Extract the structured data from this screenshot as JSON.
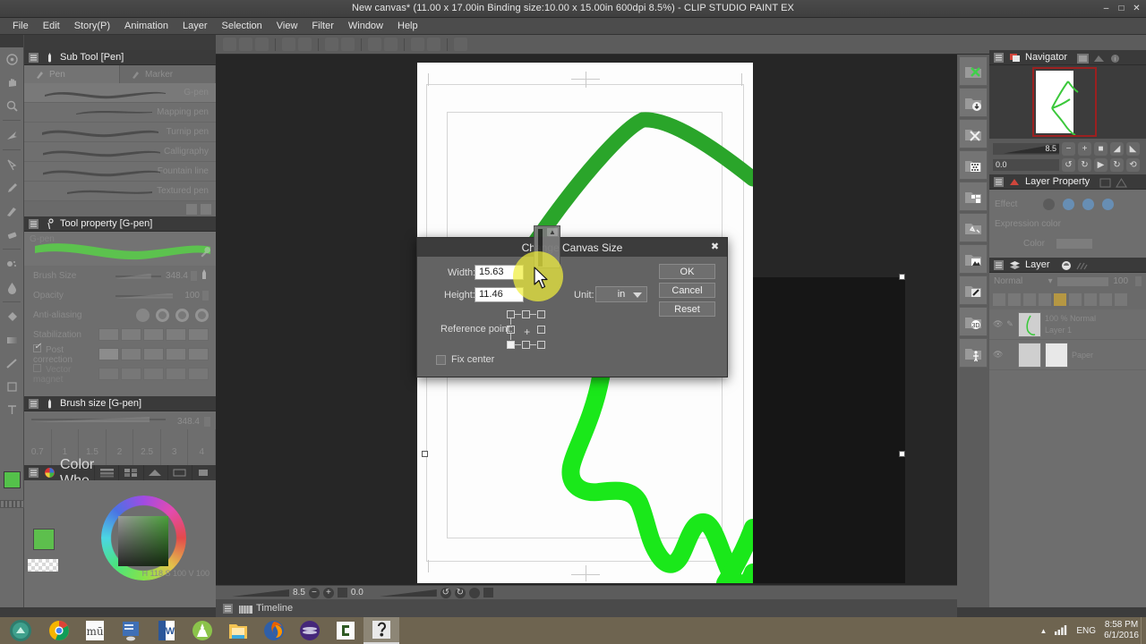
{
  "window": {
    "title": "New canvas* (11.00 x 17.00in Binding size:10.00 x 15.00in 600dpi 8.5%)  - CLIP STUDIO PAINT EX",
    "minimize": "–",
    "maximize": "□",
    "close": "✕"
  },
  "menubar": {
    "items": [
      "File",
      "Edit",
      "Story(P)",
      "Animation",
      "Layer",
      "Selection",
      "View",
      "Filter",
      "Window",
      "Help"
    ]
  },
  "subtool": {
    "title": "Sub Tool [Pen]",
    "tabs": [
      {
        "label": "Pen",
        "active": true
      },
      {
        "label": "Marker",
        "active": false
      }
    ],
    "items": [
      {
        "label": "G-pen",
        "selected": true
      },
      {
        "label": "Mapping pen",
        "selected": false
      },
      {
        "label": "Turnip pen",
        "selected": false
      },
      {
        "label": "Calligraphy",
        "selected": false
      },
      {
        "label": "Fountain line",
        "selected": false
      },
      {
        "label": "Textured pen",
        "selected": false
      }
    ]
  },
  "toolproperty": {
    "title": "Tool property [G-pen]",
    "preview_label": "G-pen",
    "rows": [
      {
        "name": "Brush Size",
        "value": "348.4"
      },
      {
        "name": "Opacity",
        "value": "100"
      },
      {
        "name": "Anti-aliasing",
        "value": ""
      },
      {
        "name": "Stabilization",
        "value": ""
      },
      {
        "name": "Post correction",
        "value": ""
      },
      {
        "name": "Vector magnet",
        "value": ""
      }
    ]
  },
  "brushsize": {
    "title": "Brush size [G-pen]",
    "current": "348.4",
    "presets": [
      "0.7",
      "1",
      "1.5",
      "2",
      "2.5",
      "3",
      "4"
    ]
  },
  "colorwheel": {
    "title": "Color Whe",
    "values": "H 118  S 100  V 100"
  },
  "navigator": {
    "title": "Navigator",
    "zoom": "8.5",
    "rotation": "0.0",
    "zoom_out_icon": "−",
    "zoom_in_icon": "+"
  },
  "layerproperty": {
    "title": "Layer Property",
    "effect_label": "Effect",
    "expression_label": "Expression color",
    "color_label": "Color"
  },
  "layerpanel": {
    "title": "Layer",
    "blend_mode": "Normal",
    "opacity": "100",
    "layers": [
      {
        "name": "Layer 1",
        "meta": "100 %  Normal"
      },
      {
        "name": "Paper",
        "meta": ""
      }
    ]
  },
  "canvas_status": {
    "zoom": "8.5",
    "rotation": "0.0",
    "zoom_out": "−",
    "zoom_in": "+"
  },
  "timeline": {
    "title": "Timeline"
  },
  "dialog": {
    "title": "Change Canvas Size",
    "close_icon": "✖",
    "width_label": "Width:",
    "width_value": "15.63",
    "height_label": "Height:",
    "height_value": "11.46",
    "unit_label": "Unit:",
    "unit_value": "in",
    "reference_label": "Reference point:",
    "reference_selected": "bottom-left",
    "fix_center_label": "Fix center",
    "fix_center_checked": false,
    "buttons": {
      "ok": "OK",
      "cancel": "Cancel",
      "reset": "Reset"
    }
  },
  "taskbar": {
    "apps": [
      "chrome-icon",
      "musescore-icon",
      "app-blue-icon",
      "word-icon",
      "android-studio-icon",
      "file-explorer-icon",
      "firefox-icon",
      "app-purple-icon",
      "clip-studio-icon",
      "clip-studio-paint-icon"
    ],
    "language": "ENG",
    "time": "8:58 PM",
    "date": "6/1/2016",
    "tray_arrow": "▲"
  }
}
